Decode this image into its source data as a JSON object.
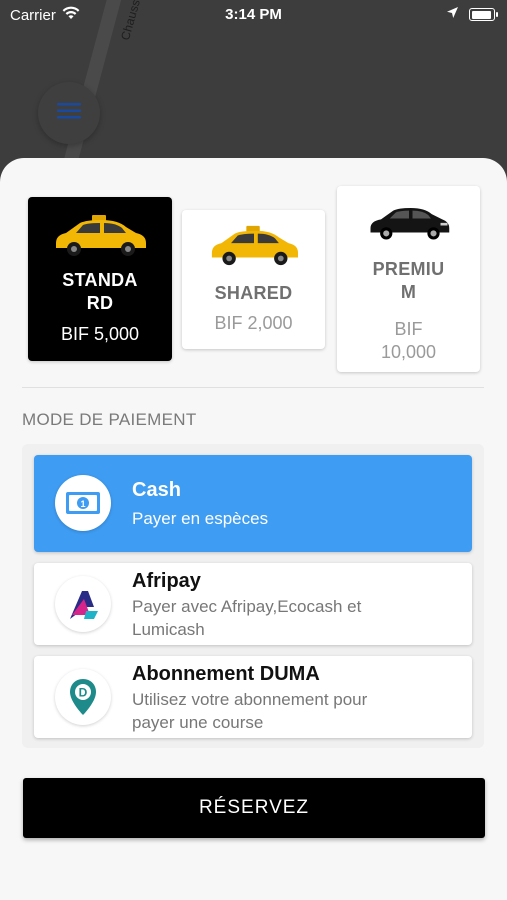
{
  "status_bar": {
    "carrier": "Carrier",
    "time": "3:14 PM",
    "icons": [
      "wifi-icon",
      "location-arrow-icon",
      "battery-icon"
    ]
  },
  "map": {
    "road_label": "Chaussee du"
  },
  "menu": {
    "icon": "hamburger-menu-icon",
    "icon_color": "#1a4aa0"
  },
  "vehicles": [
    {
      "name_line1": "STANDA",
      "name_line2": "RD",
      "price_line1": "BIF 5,000",
      "price_line2": "",
      "selected": true,
      "car_color": "#f2b705"
    },
    {
      "name_line1": "SHARED",
      "name_line2": "",
      "price_line1": "BIF 2,000",
      "price_line2": "",
      "selected": false,
      "car_color": "#f2b705"
    },
    {
      "name_line1": "PREMIU",
      "name_line2": "M",
      "price_line1": "BIF",
      "price_line2": "10,000",
      "selected": false,
      "car_color": "#111111"
    }
  ],
  "payment": {
    "section_title": "MODE DE PAIEMENT",
    "options": [
      {
        "title": "Cash",
        "desc_line1": "Payer en espèces",
        "desc_line2": "",
        "icon": "cash-icon",
        "selected": true
      },
      {
        "title": "Afripay",
        "desc_line1": "Payer avec Afripay,Ecocash et",
        "desc_line2": "Lumicash",
        "icon": "afripay-logo-icon",
        "selected": false
      },
      {
        "title": "Abonnement DUMA",
        "desc_line1": "Utilisez votre abonnement pour",
        "desc_line2": "payer une course",
        "icon": "duma-pin-icon",
        "selected": false
      }
    ]
  },
  "reserve_button": {
    "label": "RÉSERVEZ"
  },
  "colors": {
    "accent": "#3e9cf2",
    "selected_card": "#000000",
    "button": "#000000"
  }
}
